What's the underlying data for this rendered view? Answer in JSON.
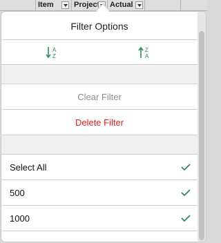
{
  "sheet_header": {
    "columns": [
      "Item",
      "Project",
      "Actual"
    ]
  },
  "popover": {
    "title": "Filter Options",
    "sort_ascending_icon": "sort-ascending-az-icon",
    "sort_descending_icon": "sort-descending-za-icon",
    "clear_filter_label": "Clear Filter",
    "delete_filter_label": "Delete Filter",
    "items": [
      {
        "label": "Select All",
        "checked": true
      },
      {
        "label": "500",
        "checked": true
      },
      {
        "label": "1000",
        "checked": true
      }
    ]
  },
  "colors": {
    "accent_green": "#2e8b57",
    "delete_red": "#e02020"
  }
}
